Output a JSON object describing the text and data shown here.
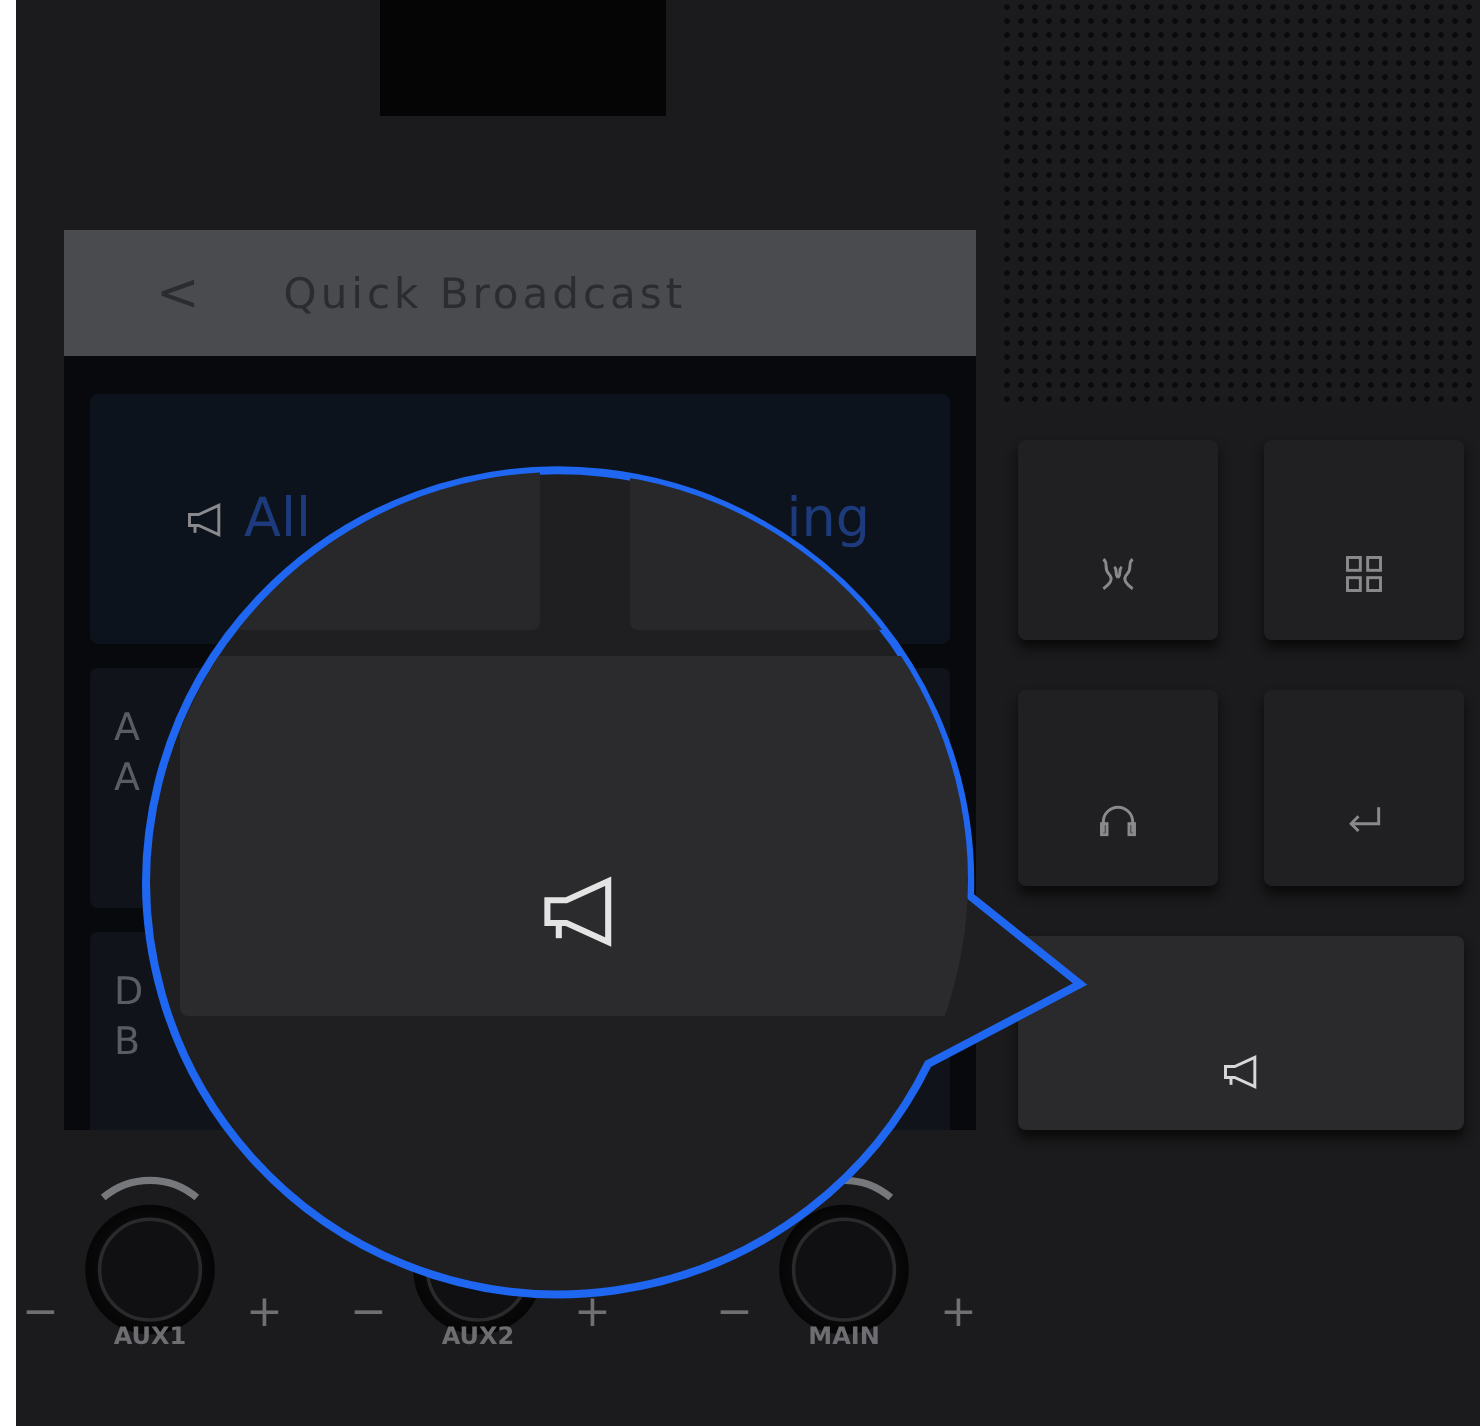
{
  "screen": {
    "header": {
      "back": "<",
      "title": "Quick Broadcast"
    },
    "cards": [
      {
        "kind": "highlight",
        "texts": [
          "All",
          "ing"
        ]
      },
      {
        "kind": "plain",
        "texts": [
          "A",
          "A"
        ]
      },
      {
        "kind": "plain",
        "texts": [
          "D",
          "B"
        ]
      }
    ]
  },
  "keys": [
    {
      "kind": "split"
    },
    {
      "kind": "grid"
    },
    {
      "kind": "headphones"
    },
    {
      "kind": "enter"
    },
    {
      "kind": "broadcast"
    }
  ],
  "knobs": [
    {
      "minus": "−",
      "plus": "+",
      "label": "AUX1"
    },
    {
      "minus": "−",
      "plus": "+",
      "label": "AUX2"
    },
    {
      "minus": "−",
      "plus": "+",
      "label": "MAIN"
    }
  ]
}
